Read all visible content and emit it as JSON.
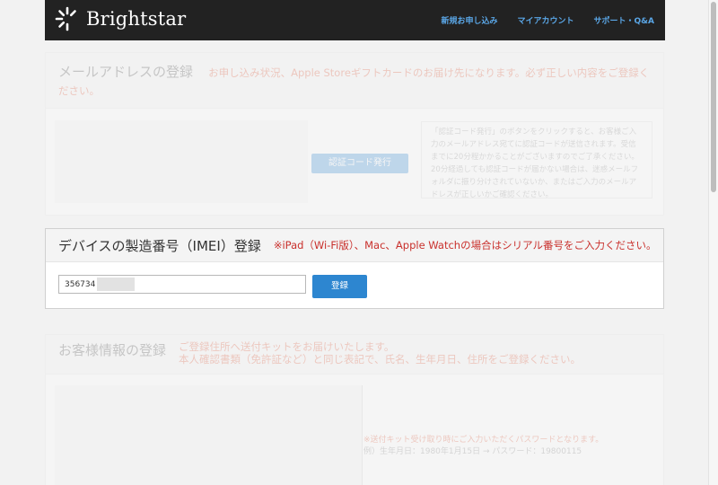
{
  "header": {
    "logo_text": "Brightstar",
    "nav": [
      "新規お申し込み",
      "マイアカウント",
      "サポート・Q&A"
    ]
  },
  "email_section": {
    "title": "メールアドレスの登録",
    "note": "お申し込み状況、Apple Storeギフトカードのお届け先になります。必ず正しい内容をご登録ください。",
    "button_label": "認証コード発行",
    "info": "「認証コード発行」のボタンをクリックすると、お客様ご入力のメールアドレス宛てに認証コードが送信されます。受信までに20分程かかることがございますのでご了承ください。20分経過しても認証コードが届かない場合は、迷惑メールフォルダに振り分けされていないか、またはご入力のメールアドレスが正しいかご確認ください。"
  },
  "imei_section": {
    "title": "デバイスの製造番号（IMEI）登録",
    "note": "※iPad（Wi-Fi版）、Mac、Apple Watchの場合はシリアル番号をご入力ください。",
    "input_value": "356734",
    "button_label": "登録"
  },
  "customer_section": {
    "title": "お客様情報の登録",
    "note_line1": "ご登録住所へ送付キットをお届けいたします。",
    "note_line2": "本人確認書類（免許証など）と同じ表記で、氏名、生年月日、住所をご登録ください。",
    "pw_note": "※送付キット受け取り時にご入力いただくパスワードとなります。",
    "pw_example": "例）生年月日：1980年1月15日 → パスワード：19800115"
  },
  "colors": {
    "header_bg": "#222222",
    "nav_link": "#5aa6e6",
    "accent_blue": "#2d86d0",
    "note_red": "#c9302c"
  }
}
